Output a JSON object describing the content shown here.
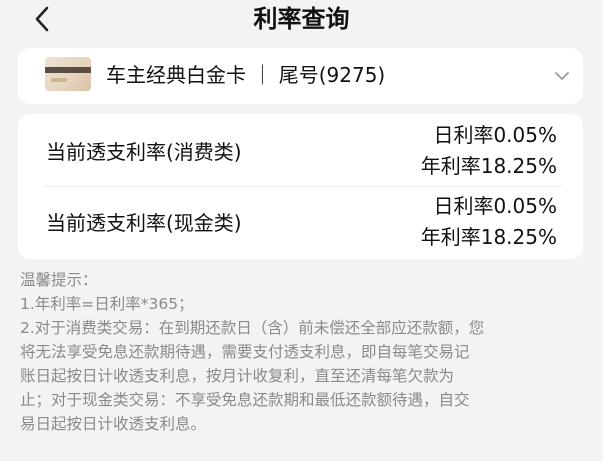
{
  "header": {
    "title": "利率查询",
    "back_icon": "chevron-left-icon"
  },
  "card": {
    "name": "车主经典白金卡 ｜ 尾号(9275)",
    "image_icon": "credit-card-icon",
    "expand_icon": "chevron-down-icon"
  },
  "rates": [
    {
      "label": "当前透支利率(消费类)",
      "daily": "日利率0.05%",
      "annual": "年利率18.25%"
    },
    {
      "label": "当前透支利率(现金类)",
      "daily": "日利率0.05%",
      "annual": "年利率18.25%"
    }
  ],
  "tips": {
    "heading": "温馨提示：",
    "lines": [
      "1.年利率=日利率*365；",
      "2.对于消费类交易：在到期还款日（含）前未偿还全部应还款额，您",
      "将无法享受免息还款期待遇，需要支付透支利息，即自每笔交易记",
      "账日起按日计收透支利息，按月计收复利，直至还清每笔欠款为",
      "止；对于现金类交易：不享受免息还款期和最低还款额待遇，自交",
      "易日起按日计收透支利息。"
    ]
  },
  "colors": {
    "background": "#f3f3f5",
    "panel": "#ffffff",
    "text_primary": "#111111",
    "text_secondary": "#8a8a8a"
  }
}
